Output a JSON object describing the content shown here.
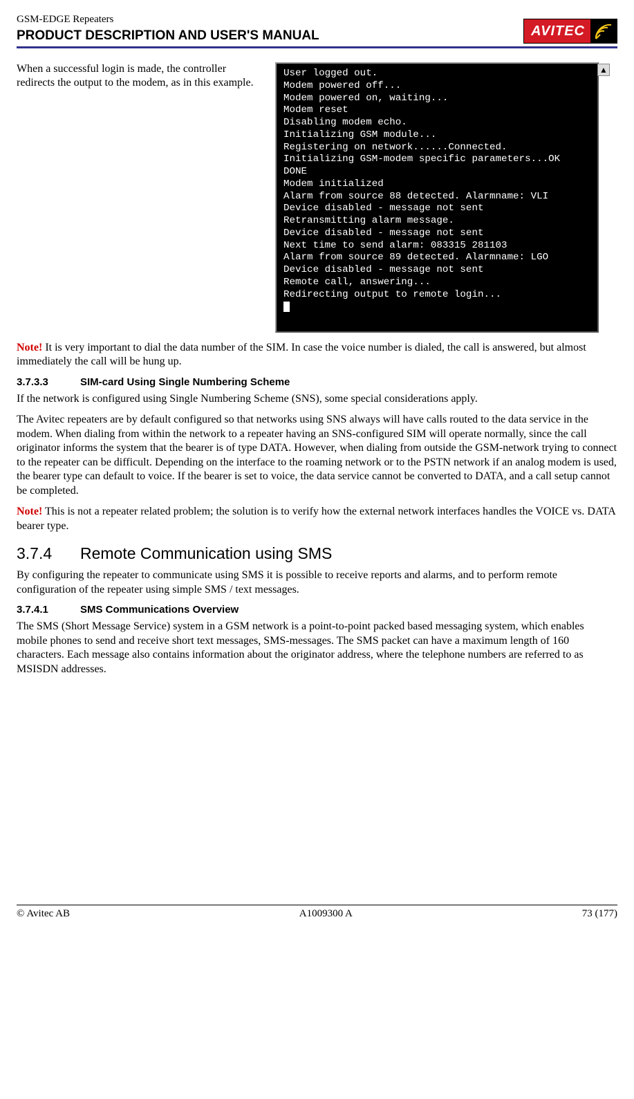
{
  "header": {
    "product_line": "GSM-EDGE Repeaters",
    "title": "PRODUCT DESCRIPTION AND USER'S MANUAL",
    "logo_text": "AVITEC"
  },
  "intro_paragraph": "When a successful login is made, the controller redirects the output to the modem, as in this example.",
  "terminal_lines": [
    "User logged out.",
    "Modem powered off...",
    "Modem powered on, waiting...",
    "Modem reset",
    "Disabling modem echo.",
    "Initializing GSM module...",
    "Registering on network......Connected.",
    "Initializing GSM-modem specific parameters...OK",
    "DONE",
    "Modem initialized",
    "Alarm from source 88 detected. Alarmname: VLI",
    "Device disabled - message not sent",
    "Retransmitting alarm message.",
    "Device disabled - message not sent",
    "Next time to send alarm: 083315 281103",
    "Alarm from source 89 detected. Alarmname: LGO",
    "Device disabled - message not sent",
    "Remote call, answering...",
    "Redirecting output to remote login..."
  ],
  "note1": {
    "label": "Note!",
    "text": " It is very important to dial the data number of the SIM. In case the voice number is dialed, the call is answered, but almost immediately the call will be hung up."
  },
  "section_3733": {
    "num": "3.7.3.3",
    "title": "SIM-card Using Single Numbering Scheme",
    "p1": "If the network is configured using Single Numbering Scheme (SNS), some special considerations apply.",
    "p2": "The Avitec repeaters are by default configured so that networks using SNS always will have calls routed to the data service in the modem. When dialing from within the network to a repeater having an SNS-configured SIM will operate normally, since the call originator informs the system that the bearer is of type DATA. However, when dialing from outside the GSM-network trying to connect to the repeater can be difficult. Depending on the interface to the roaming network or to the PSTN network if an analog modem is used, the bearer type can default to voice. If the bearer is set to voice, the data service cannot be converted to DATA, and a call setup cannot be completed."
  },
  "note2": {
    "label": "Note!",
    "text": " This is not a repeater related problem; the solution is to verify how the external network interfaces handles the VOICE vs. DATA bearer type."
  },
  "section_374": {
    "num": "3.7.4",
    "title": "Remote Communication using SMS",
    "p1": "By configuring the repeater to communicate using SMS it is possible to receive reports and alarms, and to perform remote configuration of the repeater using simple SMS / text messages."
  },
  "section_3741": {
    "num": "3.7.4.1",
    "title": "SMS Communications Overview",
    "p1": "The SMS (Short Message Service) system in a GSM network is a point-to-point packed based messaging system, which enables mobile phones to send and receive short text messages, SMS-messages. The SMS packet can have a maximum length of 160 characters.  Each message also contains information about the originator address, where the telephone numbers are referred to as MSISDN addresses."
  },
  "footer": {
    "left": "© Avitec AB",
    "center": "A1009300 A",
    "right": "73 (177)"
  }
}
